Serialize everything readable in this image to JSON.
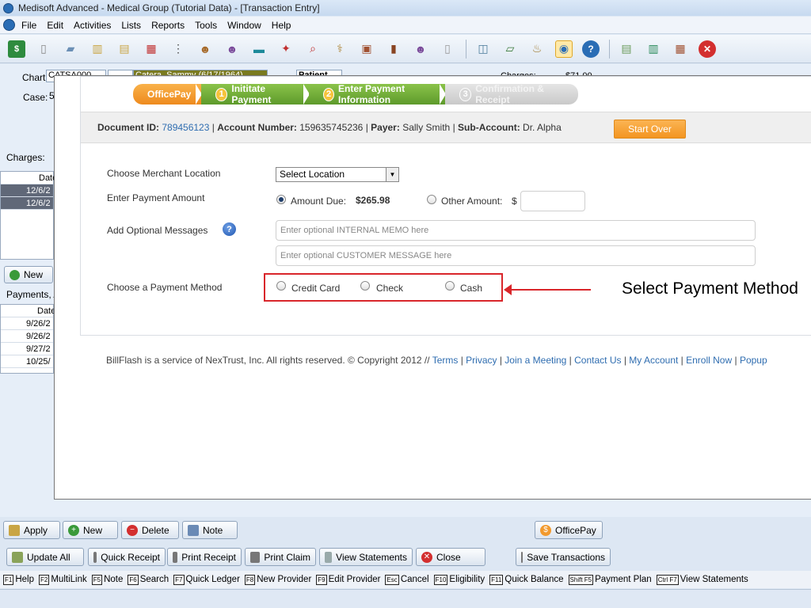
{
  "window": {
    "title": "Medisoft Advanced - Medical Group (Tutorial Data) - [Transaction Entry]"
  },
  "menu": [
    "File",
    "Edit",
    "Activities",
    "Lists",
    "Reports",
    "Tools",
    "Window",
    "Help"
  ],
  "background": {
    "chart_label": "Chart:",
    "chart_value": "CATSA000",
    "patient_name": "Catera, Sammy (6/17/1964)",
    "patient_tab": "Patient",
    "charges_summary_label": "Charges:",
    "charges_summary_value": "$71.00",
    "case_label": "Case:",
    "case_value": "5",
    "charges_label": "Charges:",
    "charges_col": "Date",
    "charges_rows": [
      "12/6/2",
      "12/6/2"
    ],
    "new_button": "New",
    "payments_label": "Payments, A",
    "payments_col": "Date",
    "payments_rows": [
      "9/26/2",
      "9/26/2",
      "9/27/2",
      "10/25/"
    ]
  },
  "officepay": {
    "steps": [
      {
        "label": "OfficePay"
      },
      {
        "num": "1",
        "label": "Inititate Payment"
      },
      {
        "num": "2",
        "label": "Enter Payment Information"
      },
      {
        "num": "3",
        "label": "Confirmation & Receipt"
      }
    ],
    "doc": {
      "document_id_label": "Document ID:",
      "document_id": "789456123",
      "account_label": "Account Number:",
      "account": "159635745236",
      "payer_label": "Payer:",
      "payer": "Sally Smith",
      "subaccount_label": "Sub-Account:",
      "subaccount": "Dr. Alpha",
      "sep": "|"
    },
    "start_over": "Start Over",
    "merchant_label": "Choose Merchant Location",
    "merchant_select": "Select Location",
    "amount_label": "Enter Payment Amount",
    "amount_due_label": "Amount Due:",
    "amount_due_value": "$265.98",
    "other_amount_label": "Other Amount:",
    "currency": "$",
    "messages_label": "Add Optional Messages",
    "internal_memo_placeholder": "Enter optional INTERNAL MEMO here",
    "customer_message_placeholder": "Enter optional CUSTOMER MESSAGE here",
    "method_label": "Choose a Payment Method",
    "methods": [
      "Credit Card",
      "Check",
      "Cash"
    ],
    "callout": "Select Payment Method",
    "footer_text": "BillFlash is a service of NexTrust, Inc. All rights reserved. © Copyright 2012 //",
    "footer_links": [
      "Terms",
      "Privacy",
      "Join a Meeting",
      "Contact Us",
      "My Account",
      "Enroll Now",
      "Popup"
    ]
  },
  "bottom_row1": [
    "Apply",
    "New",
    "Delete",
    "Note",
    "OfficePay"
  ],
  "bottom_row2": [
    "Update All",
    "Quick Receipt",
    "Print Receipt",
    "Print Claim",
    "View Statements",
    "Close",
    "Save Transactions"
  ],
  "fkeys": [
    {
      "key": "F1",
      "label": "Help"
    },
    {
      "key": "F2",
      "label": "MultiLink"
    },
    {
      "key": "F5",
      "label": "Note"
    },
    {
      "key": "F6",
      "label": "Search"
    },
    {
      "key": "F7",
      "label": "Quick Ledger"
    },
    {
      "key": "F8",
      "label": "New Provider"
    },
    {
      "key": "F9",
      "label": "Edit Provider"
    },
    {
      "key": "Esc",
      "label": "Cancel"
    },
    {
      "key": "F10",
      "label": "Eligibility"
    },
    {
      "key": "F11",
      "label": "Quick Balance"
    },
    {
      "key": "Shift F5",
      "label": "Payment Plan"
    },
    {
      "key": "Ctrl F7",
      "label": "View Statements"
    }
  ]
}
